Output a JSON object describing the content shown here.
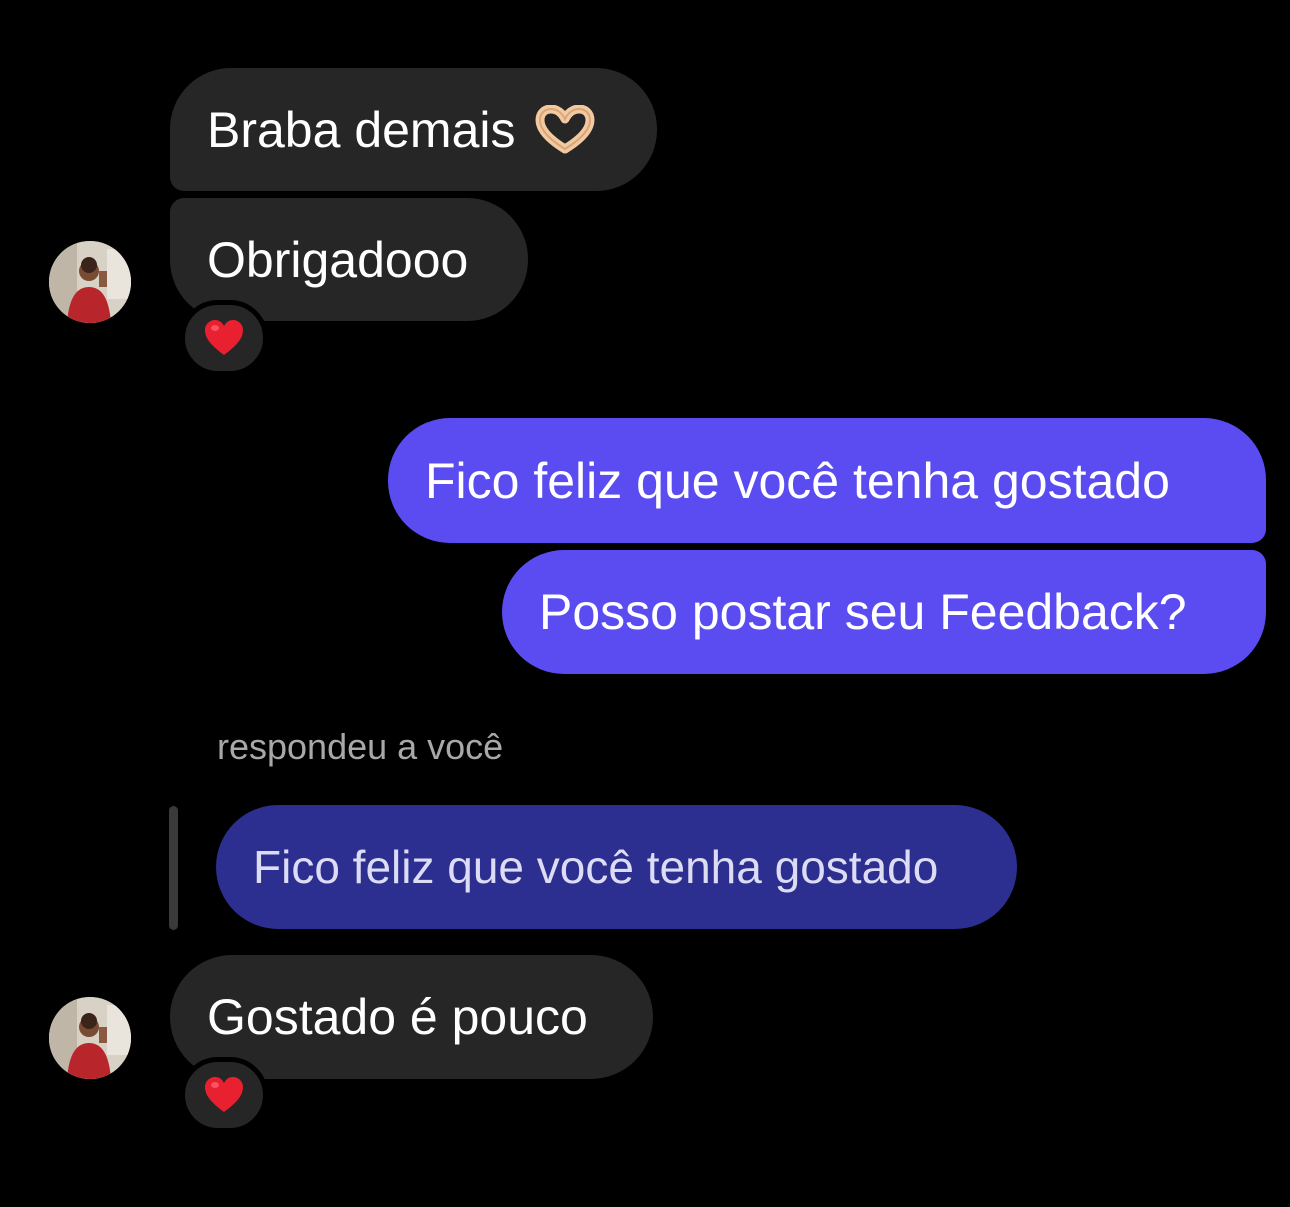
{
  "messages": [
    {
      "direction": "incoming",
      "text": "Braba demais",
      "emoji": "heart-hands-emoji"
    },
    {
      "direction": "incoming",
      "text": "Obrigadooo",
      "reaction": "red-heart-emoji"
    },
    {
      "direction": "outgoing",
      "text": "Fico feliz que você tenha gostado"
    },
    {
      "direction": "outgoing",
      "text": "Posso postar seu Feedback?"
    },
    {
      "direction": "incoming",
      "reply_label": "respondeu a você",
      "quoted_text": "Fico feliz que você tenha gostado"
    },
    {
      "direction": "incoming",
      "text": "Gostado é pouco",
      "reaction": "red-heart-emoji"
    }
  ],
  "colors": {
    "background": "#000000",
    "incoming_bubble": "#262626",
    "outgoing_bubble": "#5a4cf0",
    "quoted_bubble": "#2c2f8f",
    "reply_label": "#a8a8a8",
    "reaction_heart": "#e8202f"
  }
}
